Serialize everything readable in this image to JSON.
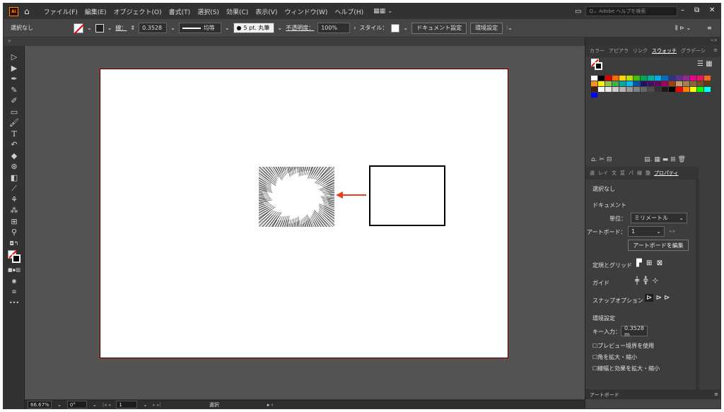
{
  "menubar": {
    "logo": "Ai",
    "items": [
      "ファイル(F)",
      "編集(E)",
      "オブジェクト(O)",
      "書式(T)",
      "選択(S)",
      "効果(C)",
      "表示(V)",
      "ウィンドウ(W)",
      "ヘルプ(H)"
    ],
    "workspace_glyph": "▦▦ ⌄",
    "help_placeholder": "Q⌄ Adobe ヘルプを検索",
    "minimize": "–",
    "restore": "⧉",
    "close": "✕"
  },
  "control": {
    "selection_label": "選択なし",
    "stroke_label": "線：",
    "stroke_value": "0.3528",
    "line_style": "均等",
    "brush": "5 pt. 丸筆",
    "opacity_label": "不透明度：",
    "opacity_value": "100%",
    "style_label": "スタイル：",
    "doc_settings_btn": "ドキュメント設定",
    "prefs_btn": "環境設定"
  },
  "toolbar": {
    "more": "•••"
  },
  "panel": {
    "tabs": [
      "カラー",
      "アピアラ",
      "リンク",
      "スウォッチ",
      "グラデーシ"
    ],
    "active_tab": "スウォッチ",
    "prop_tabs": [
      "選",
      "レイ",
      "文",
      "変",
      "パ",
      "線",
      "整",
      "プロパティ"
    ],
    "active_prop_tab": "プロパティ",
    "no_selection": "選択なし",
    "document": "ドキュメント",
    "unit_label": "単位：",
    "unit_value": "ミリメートル",
    "artboard_label": "アートボード：",
    "artboard_value": "1",
    "edit_artboard_btn": "アートボードを編集",
    "ruler_grid": "定規とグリッド",
    "guides": "ガイド",
    "snap_options": "スナップオプション",
    "preferences": "環境設定",
    "key_input_label": "キー入力：",
    "key_input_value": "0.3528 m",
    "check1": "プレビュー境界を使用",
    "check2": "角を拡大・縮小",
    "check3": "線幅と効果を拡大・縮小",
    "artboard_panel": "アートボード"
  },
  "status": {
    "zoom": "66.67%",
    "rotation": "0°",
    "page": "1",
    "mode": "選択"
  },
  "colors": {
    "swatches": [
      "#ffffff",
      "#000000",
      "#e00000",
      "#ff6a00",
      "#ffd400",
      "#b5e000",
      "#3fc100",
      "#00a651",
      "#00b3a1",
      "#00aeef",
      "#0072bc",
      "#2e3192",
      "#662d91",
      "#92278f",
      "#ec008c",
      "#ed145b",
      "#f26522",
      "#f7941d",
      "#fff200",
      "#8dc63f",
      "#39b54a",
      "#00a99d",
      "#00bff3",
      "#0054a6",
      "#1b1464",
      "#440e62",
      "#630460",
      "#9e005d",
      "#a0410d",
      "#c69c6d",
      "#a67c52",
      "#8c6239",
      "#754c24",
      "#603913",
      "#42210b",
      "#ffffff",
      "#e6e6e6",
      "#cccccc",
      "#b3b3b3",
      "#999999",
      "#808080",
      "#666666",
      "#4d4d4d",
      "#333333",
      "#1a1a1a",
      "#000000",
      "#ff0000",
      "#ff8000",
      "#ffff00",
      "#00ff00",
      "#00ffff",
      "#0000ff"
    ]
  }
}
